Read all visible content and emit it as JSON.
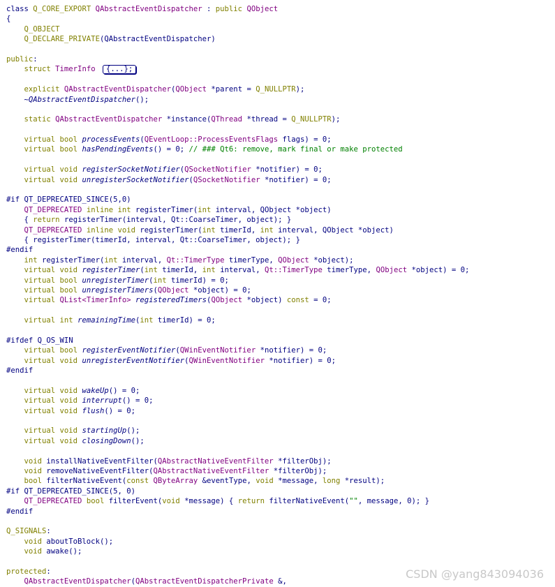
{
  "code_lines": [
    [
      [
        "t",
        "class "
      ],
      [
        "kw",
        "Q_CORE_EXPORT "
      ],
      [
        "ty",
        "QAbstractEventDispatcher"
      ],
      [
        "t",
        " : "
      ],
      [
        "kw",
        "public "
      ],
      [
        "ty",
        "QObject"
      ]
    ],
    [
      [
        "t",
        "{"
      ]
    ],
    [
      [
        "t",
        "    "
      ],
      [
        "kw",
        "Q_OBJECT"
      ]
    ],
    [
      [
        "t",
        "    "
      ],
      [
        "kw",
        "Q_DECLARE_PRIVATE"
      ],
      [
        "t",
        "(QAbstractEventDispatcher)"
      ]
    ],
    [],
    [
      [
        "kw",
        "public"
      ],
      [
        "t",
        ":"
      ]
    ],
    [
      [
        "t",
        "    "
      ],
      [
        "kw",
        "struct "
      ],
      [
        "ty",
        "TimerInfo "
      ],
      [
        "fold",
        "{...};"
      ]
    ],
    [],
    [
      [
        "t",
        "    "
      ],
      [
        "kw",
        "explicit "
      ],
      [
        "ty",
        "QAbstractEventDispatcher"
      ],
      [
        "t",
        "("
      ],
      [
        "ty",
        "QObject "
      ],
      [
        "t",
        "*parent = "
      ],
      [
        "kw",
        "Q_NULLPTR"
      ],
      [
        "t",
        ");"
      ]
    ],
    [
      [
        "t",
        "    "
      ],
      [
        "it",
        "~QAbstractEventDispatcher"
      ],
      [
        "t",
        "();"
      ]
    ],
    [],
    [
      [
        "t",
        "    "
      ],
      [
        "kw",
        "static "
      ],
      [
        "ty",
        "QAbstractEventDispatcher "
      ],
      [
        "t",
        "*instance("
      ],
      [
        "ty",
        "QThread "
      ],
      [
        "t",
        "*thread = "
      ],
      [
        "kw",
        "Q_NULLPTR"
      ],
      [
        "t",
        ");"
      ]
    ],
    [],
    [
      [
        "t",
        "    "
      ],
      [
        "kw",
        "virtual bool "
      ],
      [
        "it",
        "processEvents"
      ],
      [
        "t",
        "("
      ],
      [
        "ty",
        "QEventLoop::ProcessEventsFlags "
      ],
      [
        "t",
        "flags) = 0;"
      ]
    ],
    [
      [
        "t",
        "    "
      ],
      [
        "kw",
        "virtual bool "
      ],
      [
        "it",
        "hasPendingEvents"
      ],
      [
        "t",
        "() = 0; "
      ],
      [
        "cm",
        "// ### Qt6: remove, mark final or make protected"
      ]
    ],
    [],
    [
      [
        "t",
        "    "
      ],
      [
        "kw",
        "virtual void "
      ],
      [
        "it",
        "registerSocketNotifier"
      ],
      [
        "t",
        "("
      ],
      [
        "ty",
        "QSocketNotifier "
      ],
      [
        "t",
        "*notifier) = 0;"
      ]
    ],
    [
      [
        "t",
        "    "
      ],
      [
        "kw",
        "virtual void "
      ],
      [
        "it",
        "unregisterSocketNotifier"
      ],
      [
        "t",
        "("
      ],
      [
        "ty",
        "QSocketNotifier "
      ],
      [
        "t",
        "*notifier) = 0;"
      ]
    ],
    [],
    [
      [
        "t",
        "#if QT_DEPRECATED_SINCE(5,0)"
      ]
    ],
    [
      [
        "t",
        "    "
      ],
      [
        "ty",
        "QT_DEPRECATED "
      ],
      [
        "kw",
        "inline int "
      ],
      [
        "t",
        "registerTimer("
      ],
      [
        "kw",
        "int "
      ],
      [
        "t",
        "interval, QObject *object)"
      ]
    ],
    [
      [
        "t",
        "    { "
      ],
      [
        "kw",
        "return "
      ],
      [
        "t",
        "registerTimer(interval, Qt::CoarseTimer, object); }"
      ]
    ],
    [
      [
        "t",
        "    "
      ],
      [
        "ty",
        "QT_DEPRECATED "
      ],
      [
        "kw",
        "inline void "
      ],
      [
        "t",
        "registerTimer("
      ],
      [
        "kw",
        "int "
      ],
      [
        "t",
        "timerId, "
      ],
      [
        "kw",
        "int "
      ],
      [
        "t",
        "interval, QObject *object)"
      ]
    ],
    [
      [
        "t",
        "    { registerTimer(timerId, interval, Qt::CoarseTimer, object); }"
      ]
    ],
    [
      [
        "t",
        "#endif"
      ]
    ],
    [
      [
        "t",
        "    "
      ],
      [
        "kw",
        "int "
      ],
      [
        "t",
        "registerTimer("
      ],
      [
        "kw",
        "int "
      ],
      [
        "t",
        "interval, "
      ],
      [
        "ty",
        "Qt::TimerType "
      ],
      [
        "t",
        "timerType, "
      ],
      [
        "ty",
        "QObject "
      ],
      [
        "t",
        "*object);"
      ]
    ],
    [
      [
        "t",
        "    "
      ],
      [
        "kw",
        "virtual void "
      ],
      [
        "it",
        "registerTimer"
      ],
      [
        "t",
        "("
      ],
      [
        "kw",
        "int "
      ],
      [
        "t",
        "timerId, "
      ],
      [
        "kw",
        "int "
      ],
      [
        "t",
        "interval, "
      ],
      [
        "ty",
        "Qt::TimerType "
      ],
      [
        "t",
        "timerType, "
      ],
      [
        "ty",
        "QObject "
      ],
      [
        "t",
        "*object) = 0;"
      ]
    ],
    [
      [
        "t",
        "    "
      ],
      [
        "kw",
        "virtual bool "
      ],
      [
        "it",
        "unregisterTimer"
      ],
      [
        "t",
        "("
      ],
      [
        "kw",
        "int "
      ],
      [
        "t",
        "timerId) = 0;"
      ]
    ],
    [
      [
        "t",
        "    "
      ],
      [
        "kw",
        "virtual bool "
      ],
      [
        "it",
        "unregisterTimers"
      ],
      [
        "t",
        "("
      ],
      [
        "ty",
        "QObject "
      ],
      [
        "t",
        "*object) = 0;"
      ]
    ],
    [
      [
        "t",
        "    "
      ],
      [
        "kw",
        "virtual "
      ],
      [
        "ty",
        "QList<TimerInfo> "
      ],
      [
        "it",
        "registeredTimers"
      ],
      [
        "t",
        "("
      ],
      [
        "ty",
        "QObject "
      ],
      [
        "t",
        "*object) "
      ],
      [
        "kw",
        "const "
      ],
      [
        "t",
        "= 0;"
      ]
    ],
    [],
    [
      [
        "t",
        "    "
      ],
      [
        "kw",
        "virtual int "
      ],
      [
        "it",
        "remainingTime"
      ],
      [
        "t",
        "("
      ],
      [
        "kw",
        "int "
      ],
      [
        "t",
        "timerId) = 0;"
      ]
    ],
    [],
    [
      [
        "t",
        "#ifdef Q_OS_WIN"
      ]
    ],
    [
      [
        "t",
        "    "
      ],
      [
        "kw",
        "virtual bool "
      ],
      [
        "it",
        "registerEventNotifier"
      ],
      [
        "t",
        "("
      ],
      [
        "ty",
        "QWinEventNotifier "
      ],
      [
        "t",
        "*notifier) = 0;"
      ]
    ],
    [
      [
        "t",
        "    "
      ],
      [
        "kw",
        "virtual void "
      ],
      [
        "it",
        "unregisterEventNotifier"
      ],
      [
        "t",
        "("
      ],
      [
        "ty",
        "QWinEventNotifier "
      ],
      [
        "t",
        "*notifier) = 0;"
      ]
    ],
    [
      [
        "t",
        "#endif"
      ]
    ],
    [],
    [
      [
        "t",
        "    "
      ],
      [
        "kw",
        "virtual void "
      ],
      [
        "it",
        "wakeUp"
      ],
      [
        "t",
        "() = 0;"
      ]
    ],
    [
      [
        "t",
        "    "
      ],
      [
        "kw",
        "virtual void "
      ],
      [
        "it",
        "interrupt"
      ],
      [
        "t",
        "() = 0;"
      ]
    ],
    [
      [
        "t",
        "    "
      ],
      [
        "kw",
        "virtual void "
      ],
      [
        "it",
        "flush"
      ],
      [
        "t",
        "() = 0;"
      ]
    ],
    [],
    [
      [
        "t",
        "    "
      ],
      [
        "kw",
        "virtual void "
      ],
      [
        "it",
        "startingUp"
      ],
      [
        "t",
        "();"
      ]
    ],
    [
      [
        "t",
        "    "
      ],
      [
        "kw",
        "virtual void "
      ],
      [
        "it",
        "closingDown"
      ],
      [
        "t",
        "();"
      ]
    ],
    [],
    [
      [
        "t",
        "    "
      ],
      [
        "kw",
        "void "
      ],
      [
        "t",
        "installNativeEventFilter("
      ],
      [
        "ty",
        "QAbstractNativeEventFilter "
      ],
      [
        "t",
        "*filterObj);"
      ]
    ],
    [
      [
        "t",
        "    "
      ],
      [
        "kw",
        "void "
      ],
      [
        "t",
        "removeNativeEventFilter("
      ],
      [
        "ty",
        "QAbstractNativeEventFilter "
      ],
      [
        "t",
        "*filterObj);"
      ]
    ],
    [
      [
        "t",
        "    "
      ],
      [
        "kw",
        "bool "
      ],
      [
        "t",
        "filterNativeEvent("
      ],
      [
        "kw",
        "const "
      ],
      [
        "ty",
        "QByteArray "
      ],
      [
        "t",
        "&eventType, "
      ],
      [
        "kw",
        "void "
      ],
      [
        "t",
        "*message, "
      ],
      [
        "kw",
        "long "
      ],
      [
        "t",
        "*result);"
      ]
    ],
    [
      [
        "t",
        "#if QT_DEPRECATED_SINCE(5, 0)"
      ]
    ],
    [
      [
        "t",
        "    "
      ],
      [
        "ty",
        "QT_DEPRECATED "
      ],
      [
        "kw",
        "bool "
      ],
      [
        "t",
        "filterEvent("
      ],
      [
        "kw",
        "void "
      ],
      [
        "t",
        "*message) { "
      ],
      [
        "kw",
        "return "
      ],
      [
        "t",
        "filterNativeEvent("
      ],
      [
        "st",
        "\"\""
      ],
      [
        "t",
        ", message, 0); }"
      ]
    ],
    [
      [
        "t",
        "#endif"
      ]
    ],
    [],
    [
      [
        "kw",
        "Q_SIGNALS"
      ],
      [
        "t",
        ":"
      ]
    ],
    [
      [
        "t",
        "    "
      ],
      [
        "kw",
        "void "
      ],
      [
        "t",
        "aboutToBlock();"
      ]
    ],
    [
      [
        "t",
        "    "
      ],
      [
        "kw",
        "void "
      ],
      [
        "t",
        "awake();"
      ]
    ],
    [],
    [
      [
        "kw",
        "protected"
      ],
      [
        "t",
        ":"
      ]
    ],
    [
      [
        "t",
        "    "
      ],
      [
        "ty",
        "QAbstractEventDispatcher"
      ],
      [
        "t",
        "("
      ],
      [
        "ty",
        "QAbstractEventDispatcherPrivate "
      ],
      [
        "t",
        "&,"
      ]
    ]
  ],
  "watermark": "CSDN @yang843094036",
  "colors": {
    "background": "#ffffff",
    "text": "#000080",
    "keyword": "#808000",
    "type": "#800080",
    "comment": "#008000"
  }
}
